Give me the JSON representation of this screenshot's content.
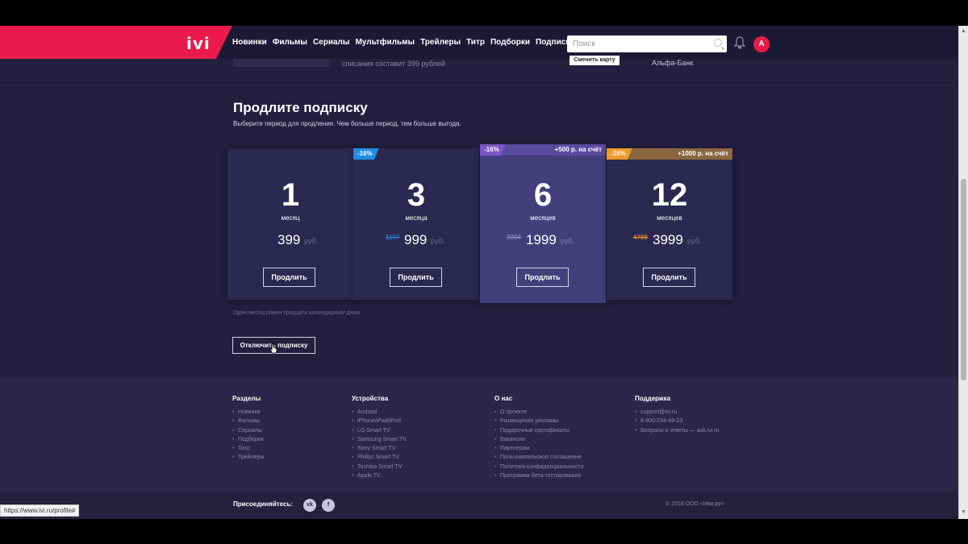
{
  "header": {
    "logo": "ivi",
    "nav": [
      "Новинки",
      "Фильмы",
      "Сериалы",
      "Мультфильмы",
      "Трейлеры",
      "Титр",
      "Подборки",
      "Подписка"
    ],
    "search_placeholder": "Поиск",
    "avatar_letter": "A"
  },
  "payment": {
    "note": "списания составит 399 рублей",
    "change_card": "Сменить карту",
    "bank": "Альфа-Банк"
  },
  "renew": {
    "title": "Продлите подписку",
    "subtitle": "Выберите период для продления. Чем больше период, тем больше выгода.",
    "plans": [
      {
        "count": "1",
        "unit": "месяц",
        "old_price": "",
        "price": "399",
        "currency": "руб.",
        "button": "Продлить",
        "discount": "",
        "bonus": ""
      },
      {
        "count": "3",
        "unit": "месяца",
        "old_price": "1197",
        "price": "999",
        "currency": "руб.",
        "button": "Продлить",
        "discount": "-16%",
        "bonus": ""
      },
      {
        "count": "6",
        "unit": "месяцев",
        "old_price": "2394",
        "price": "1999",
        "currency": "руб.",
        "button": "Продлить",
        "discount": "-16%",
        "bonus": "+500 р. на счёт"
      },
      {
        "count": "12",
        "unit": "месяцев",
        "old_price": "4788",
        "price": "3999",
        "currency": "руб.",
        "button": "Продлить",
        "discount": "-16%",
        "bonus": "+1000 р. на счёт"
      }
    ],
    "note": "Один месяц равен тридцати календарным дням",
    "cancel_button": "Отключить подписку"
  },
  "colors": {
    "brand_red": "#ea1a4a",
    "badge_blue": "#1e8ee6",
    "badge_purple": "#7b55c8",
    "bonus_purple": "#5a4ba0",
    "badge_orange": "#f39a2a",
    "bonus_brown": "#8a6640"
  },
  "footer": {
    "columns": [
      {
        "title": "Разделы",
        "items": [
          "Новинки",
          "Фильмы",
          "Сериалы",
          "Подборки",
          "Титр",
          "Трейлеры"
        ]
      },
      {
        "title": "Устройства",
        "items": [
          "Android",
          "iPhone/iPad/iPod",
          "LG Smart TV",
          "Samsung Smart TV",
          "Sony Smart TV",
          "Philips Smart TV",
          "Toshiba Smart TV",
          "Apple TV"
        ]
      },
      {
        "title": "О нас",
        "items": [
          "О проекте",
          "Размещение рекламы",
          "Подарочные сертификаты",
          "Вакансии",
          "Партнерам",
          "Пользовательское соглашение",
          "Политика конфиденциальности",
          "Программа бета-тестирования"
        ]
      },
      {
        "title": "Поддержка",
        "items": [
          "support@ivi.ru",
          "8-800-234-49-23",
          "Вопросы и ответы — ask.ivi.ru"
        ]
      }
    ],
    "join": "Присоединяйтесь:",
    "social": [
      "vk-icon",
      "facebook-icon"
    ],
    "copyright": "© 2018 ООО «Иви.ру»"
  },
  "status_url": "https://www.ivi.ru/profile#"
}
